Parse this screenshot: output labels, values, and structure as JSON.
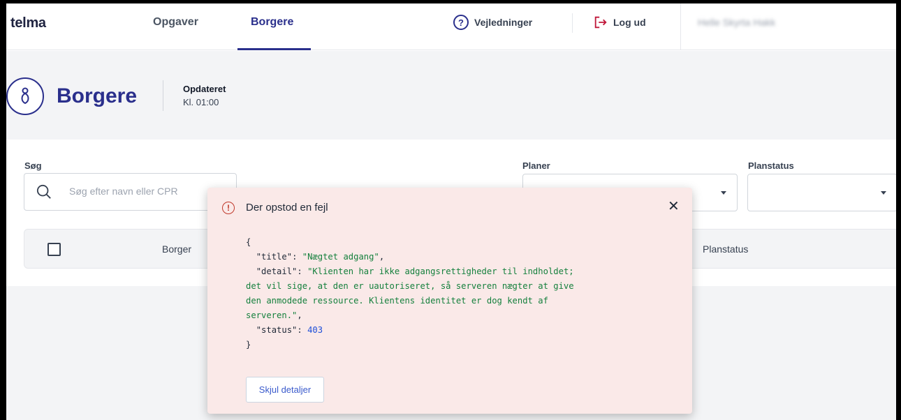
{
  "nav": {
    "logo": "telma",
    "tabs": [
      {
        "label": "Opgaver",
        "active": false
      },
      {
        "label": "Borgere",
        "active": true
      }
    ],
    "help_label": "Vejledninger",
    "logout_label": "Log ud",
    "user_name": "Helle Skyrta Hakk",
    "accent_color": "#2a2f8c"
  },
  "header": {
    "title": "Borgere",
    "updated_label": "Opdateret",
    "updated_time": "Kl. 01:00"
  },
  "filters": {
    "search_label": "Søg",
    "search_placeholder": "Søg efter navn eller CPR",
    "planer_label": "Planer",
    "planer_value": "",
    "planstatus_label": "Planstatus",
    "planstatus_value": ""
  },
  "table": {
    "columns": [
      "Borger",
      "Planstatus"
    ]
  },
  "error_dialog": {
    "title": "Der opstod en fejl",
    "close_glyph": "✕",
    "json_lines": {
      "open": "{",
      "title_key": "\"title\"",
      "title_value": "\"Nægtet adgang\"",
      "detail_key": "\"detail\"",
      "detail_value_line1": "\"Klienten har ikke adgangsrettigheder til indholdet;",
      "detail_value_line2": "det vil sige, at den er uautoriseret, så serveren nægter at give",
      "detail_value_line3": "den anmodede ressource. Klientens identitet er dog kendt af",
      "detail_value_line4": "serveren.\"",
      "status_key": "\"status\"",
      "status_value": "403",
      "close": "}"
    },
    "toggle_button": "Skjul detaljer",
    "background_color": "#fae9e8"
  }
}
